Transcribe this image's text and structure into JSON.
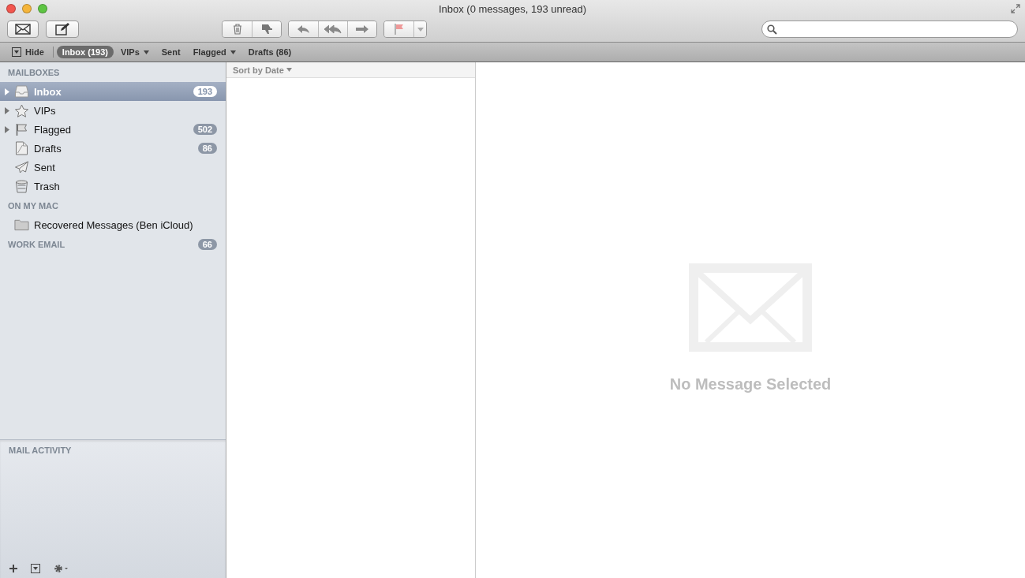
{
  "window": {
    "title": "Inbox (0 messages, 193 unread)"
  },
  "favorites_bar": [
    {
      "label": "Inbox (193)",
      "selected": true,
      "menu": false
    },
    {
      "label": "VIPs",
      "selected": false,
      "menu": true
    },
    {
      "label": "Sent",
      "selected": false,
      "menu": false
    },
    {
      "label": "Flagged",
      "selected": false,
      "menu": true
    },
    {
      "label": "Drafts (86)",
      "selected": false,
      "menu": false
    }
  ],
  "hide_button": "Hide",
  "sidebar": {
    "sections": [
      {
        "heading": "MAILBOXES",
        "items": [
          {
            "kind": "inbox",
            "label": "Inbox",
            "count": "193",
            "disclosure": true,
            "selected": true
          },
          {
            "kind": "star",
            "label": "VIPs",
            "disclosure": true,
            "selected": false
          },
          {
            "kind": "flag",
            "label": "Flagged",
            "count": "502",
            "disclosure": true,
            "selected": false
          },
          {
            "kind": "draft",
            "label": "Drafts",
            "count": "86",
            "disclosure": false,
            "selected": false
          },
          {
            "kind": "sent",
            "label": "Sent",
            "disclosure": false,
            "selected": false
          },
          {
            "kind": "trash",
            "label": "Trash",
            "disclosure": false,
            "selected": false
          }
        ]
      },
      {
        "heading": "ON MY MAC",
        "items": [
          {
            "kind": "folder",
            "label": "Recovered Messages (Ben iCloud)",
            "disclosure": false,
            "selected": false
          }
        ]
      },
      {
        "heading": "WORK EMAIL",
        "count": "66"
      }
    ],
    "activity_heading": "MAIL ACTIVITY"
  },
  "message_list": {
    "sort_label": "Sort by Date"
  },
  "viewer": {
    "empty_text": "No Message Selected"
  }
}
